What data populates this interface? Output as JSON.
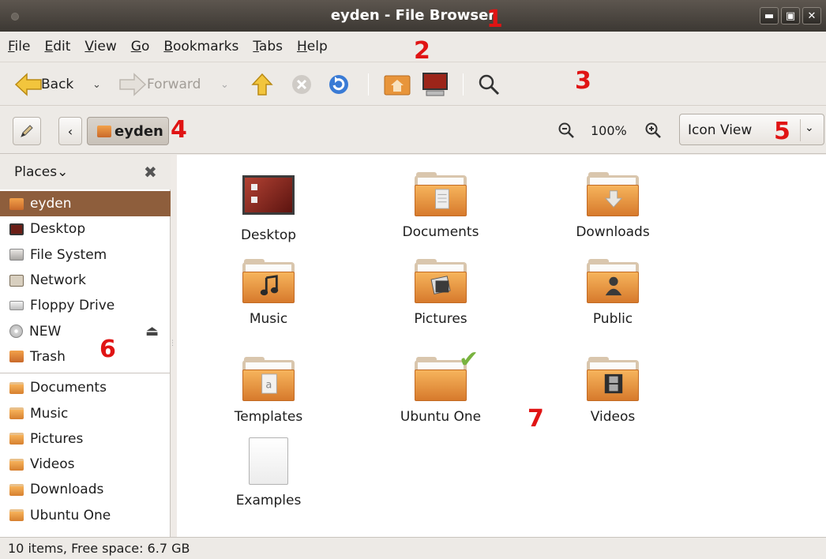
{
  "window": {
    "title": "eyden - File Browser",
    "controls": [
      "minimize",
      "maximize",
      "close"
    ]
  },
  "annotations": [
    "1",
    "2",
    "3",
    "4",
    "5",
    "6",
    "7"
  ],
  "menubar": {
    "items": [
      {
        "pre": "",
        "u": "F",
        "post": "ile"
      },
      {
        "pre": "",
        "u": "E",
        "post": "dit"
      },
      {
        "pre": "",
        "u": "V",
        "post": "iew"
      },
      {
        "pre": "",
        "u": "G",
        "post": "o"
      },
      {
        "pre": "",
        "u": "B",
        "post": "ookmarks"
      },
      {
        "pre": "",
        "u": "T",
        "post": "abs"
      },
      {
        "pre": "",
        "u": "H",
        "post": "elp"
      }
    ]
  },
  "toolbar": {
    "back_label": "Back",
    "forward_label": "Forward",
    "icons": [
      "back-arrow-icon",
      "forward-arrow-icon",
      "up-arrow-icon",
      "stop-icon",
      "reload-icon",
      "home-folder-icon",
      "computer-icon",
      "search-icon"
    ]
  },
  "location": {
    "crumb": "eyden",
    "zoom_level": "100%",
    "view_mode": "Icon View"
  },
  "sidebar": {
    "title": "Places",
    "items": [
      {
        "label": "eyden",
        "icon": "home-folder-icon",
        "selected": true
      },
      {
        "label": "Desktop",
        "icon": "desktop-icon"
      },
      {
        "label": "File System",
        "icon": "harddisk-icon"
      },
      {
        "label": "Network",
        "icon": "network-icon"
      },
      {
        "label": "Floppy Drive",
        "icon": "floppy-icon"
      },
      {
        "label": "NEW",
        "icon": "cd-icon",
        "eject": true
      },
      {
        "label": "Trash",
        "icon": "trash-icon"
      }
    ],
    "bookmarks": [
      {
        "label": "Documents",
        "icon": "documents-folder-icon"
      },
      {
        "label": "Music",
        "icon": "music-folder-icon"
      },
      {
        "label": "Pictures",
        "icon": "pictures-folder-icon"
      },
      {
        "label": "Videos",
        "icon": "videos-folder-icon"
      },
      {
        "label": "Downloads",
        "icon": "downloads-folder-icon"
      },
      {
        "label": "Ubuntu One",
        "icon": "folder-icon"
      }
    ]
  },
  "files": [
    {
      "name": "Desktop",
      "kind": "desktop"
    },
    {
      "name": "Documents",
      "kind": "folder",
      "emblem": "document-emblem-icon"
    },
    {
      "name": "Downloads",
      "kind": "folder",
      "emblem": "download-arrow-icon"
    },
    {
      "name": "Music",
      "kind": "folder",
      "emblem": "music-note-icon"
    },
    {
      "name": "Pictures",
      "kind": "folder",
      "emblem": "picture-frame-icon"
    },
    {
      "name": "Public",
      "kind": "folder",
      "emblem": "person-icon"
    },
    {
      "name": "Templates",
      "kind": "folder",
      "emblem": "template-icon"
    },
    {
      "name": "Ubuntu One",
      "kind": "folder",
      "emblem": "checkmark-icon"
    },
    {
      "name": "Videos",
      "kind": "folder",
      "emblem": "film-icon"
    },
    {
      "name": "Examples",
      "kind": "file"
    }
  ],
  "status": {
    "text": "10 items, Free space: 6.7 GB"
  }
}
